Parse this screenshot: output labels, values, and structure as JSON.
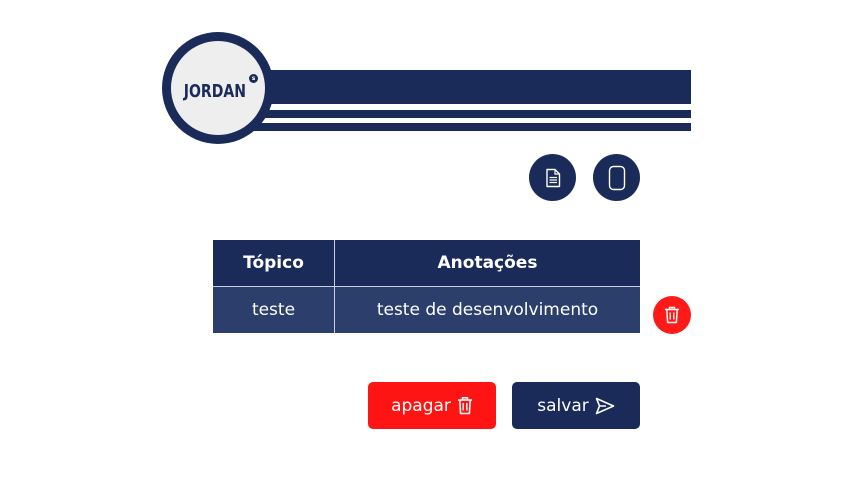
{
  "header": {
    "logo_text": "JORDAN",
    "logo_badge": "s"
  },
  "toolbar": {
    "document_icon": "document-icon",
    "phone_icon": "phone-icon"
  },
  "table": {
    "columns": [
      "Tópico",
      "Anotações"
    ],
    "rows": [
      {
        "topic": "teste",
        "notes": "teste de desenvolvimento"
      }
    ]
  },
  "actions": {
    "delete_label": "apagar",
    "save_label": "salvar"
  },
  "colors": {
    "navy": "#1a2b5a",
    "row": "#2c3f6c",
    "danger": "#ff1414"
  }
}
